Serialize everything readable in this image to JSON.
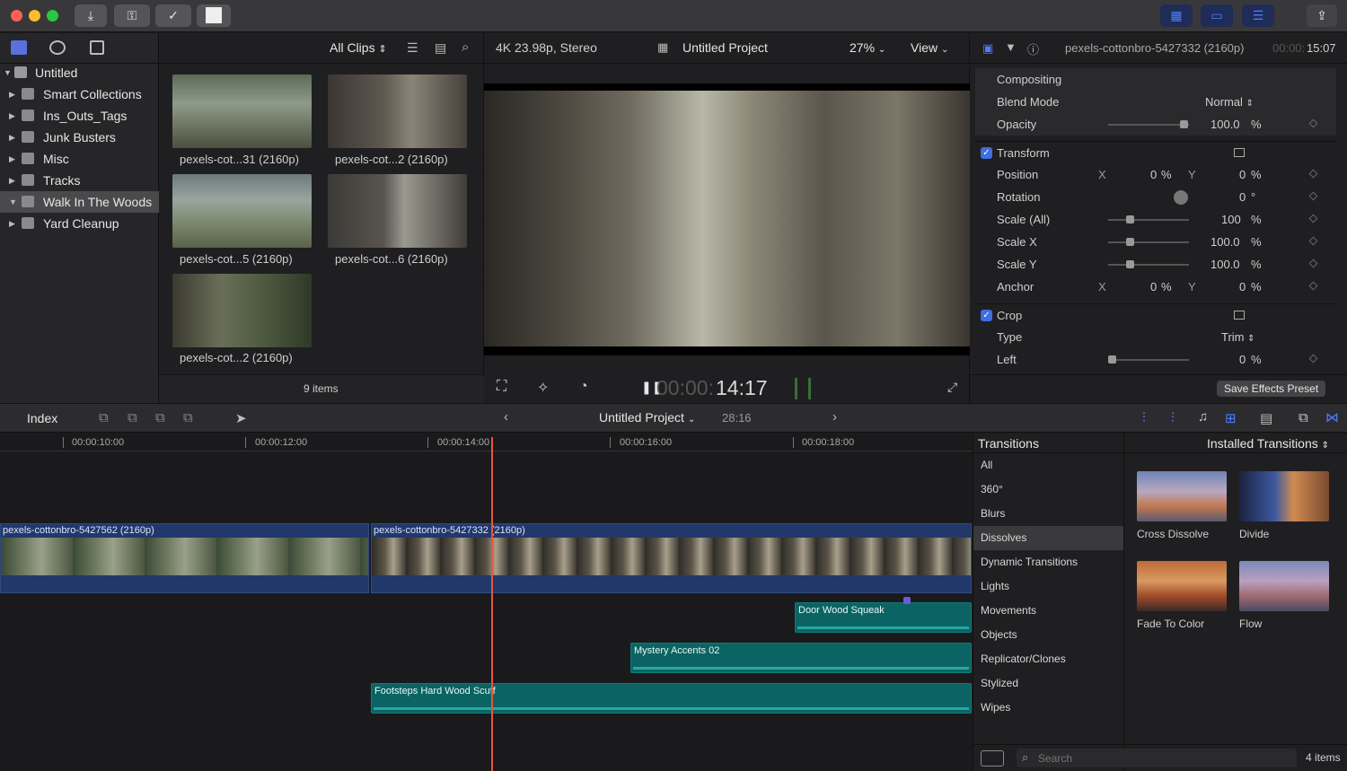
{
  "colors": {
    "accent": "#4f7dff",
    "playhead": "#e8553c",
    "video_clip": "#22386a",
    "audio_clip": "#0b6463"
  },
  "toolbar": {
    "icons": [
      "import-icon",
      "key-icon",
      "checkmark-icon",
      "square-icon"
    ],
    "right_icons": [
      "grid-layout-icon",
      "browser-layout-icon",
      "inspector-icon",
      "share-icon"
    ]
  },
  "library": {
    "root": "Untitled",
    "items": [
      {
        "label": "Smart Collections",
        "expanded": false
      },
      {
        "label": "Ins_Outs_Tags",
        "expanded": false
      },
      {
        "label": "Junk Busters",
        "expanded": false
      },
      {
        "label": "Misc",
        "expanded": false
      },
      {
        "label": "Tracks",
        "expanded": false
      },
      {
        "label": "Walk In The Woods",
        "expanded": true,
        "selected": true
      },
      {
        "label": "Yard Cleanup",
        "expanded": false
      }
    ]
  },
  "browser": {
    "filter": "All Clips",
    "clips": [
      {
        "name": "pexels-cot...31 (2160p)"
      },
      {
        "name": "pexels-cot...2 (2160p)"
      },
      {
        "name": "pexels-cot...5 (2160p)"
      },
      {
        "name": "pexels-cot...6 (2160p)"
      },
      {
        "name": "pexels-cot...2 (2160p)"
      }
    ],
    "count": "9 items"
  },
  "viewer": {
    "format": "4K 23.98p, Stereo",
    "project": "Untitled Project",
    "zoom": "27%",
    "view_label": "View",
    "timecode_dim": "00:00:",
    "timecode": "14:17"
  },
  "inspector": {
    "clip_name": "pexels-cottonbro-5427332 (2160p)",
    "duration_dim": "00:00:",
    "duration": "15:07",
    "compositing": "Compositing",
    "blend_mode_label": "Blend Mode",
    "blend_mode": "Normal",
    "opacity_label": "Opacity",
    "opacity": "100.0",
    "transform": "Transform",
    "position_label": "Position",
    "position_x": "0",
    "position_y": "0",
    "rotation_label": "Rotation",
    "rotation": "0",
    "scale_all_label": "Scale (All)",
    "scale_all": "100",
    "scale_x_label": "Scale X",
    "scale_x": "100.0",
    "scale_y_label": "Scale Y",
    "scale_y": "100.0",
    "anchor_label": "Anchor",
    "anchor_x": "0",
    "anchor_y": "0",
    "crop": "Crop",
    "type_label": "Type",
    "type": "Trim",
    "left_label": "Left",
    "left": "0",
    "pct": "%",
    "deg": "°",
    "x": "X",
    "y": "Y",
    "save_preset": "Save Effects Preset"
  },
  "timeline": {
    "index": "Index",
    "project": "Untitled Project",
    "duration": "28:16",
    "ruler": [
      "00:00:10:00",
      "00:00:12:00",
      "00:00:14:00",
      "00:00:16:00",
      "00:00:18:00"
    ],
    "video_clips": [
      {
        "name": "pexels-cottonbro-5427562 (2160p)"
      },
      {
        "name": "pexels-cottonbro-5427332 (2160p)"
      }
    ],
    "audio_clips": [
      {
        "name": "Door Wood Squeak"
      },
      {
        "name": "Mystery Accents 02"
      },
      {
        "name": "Footsteps Hard Wood Scuff"
      }
    ]
  },
  "transitions": {
    "title": "Transitions",
    "source": "Installed Transitions",
    "categories": [
      "All",
      "360°",
      "Blurs",
      "Dissolves",
      "Dynamic Transitions",
      "Lights",
      "Movements",
      "Objects",
      "Replicator/Clones",
      "Stylized",
      "Wipes"
    ],
    "selected_category": "Dissolves",
    "items": [
      {
        "name": "Cross Dissolve"
      },
      {
        "name": "Divide"
      },
      {
        "name": "Fade To Color"
      },
      {
        "name": "Flow"
      }
    ],
    "search_placeholder": "Search",
    "count": "4 items"
  }
}
